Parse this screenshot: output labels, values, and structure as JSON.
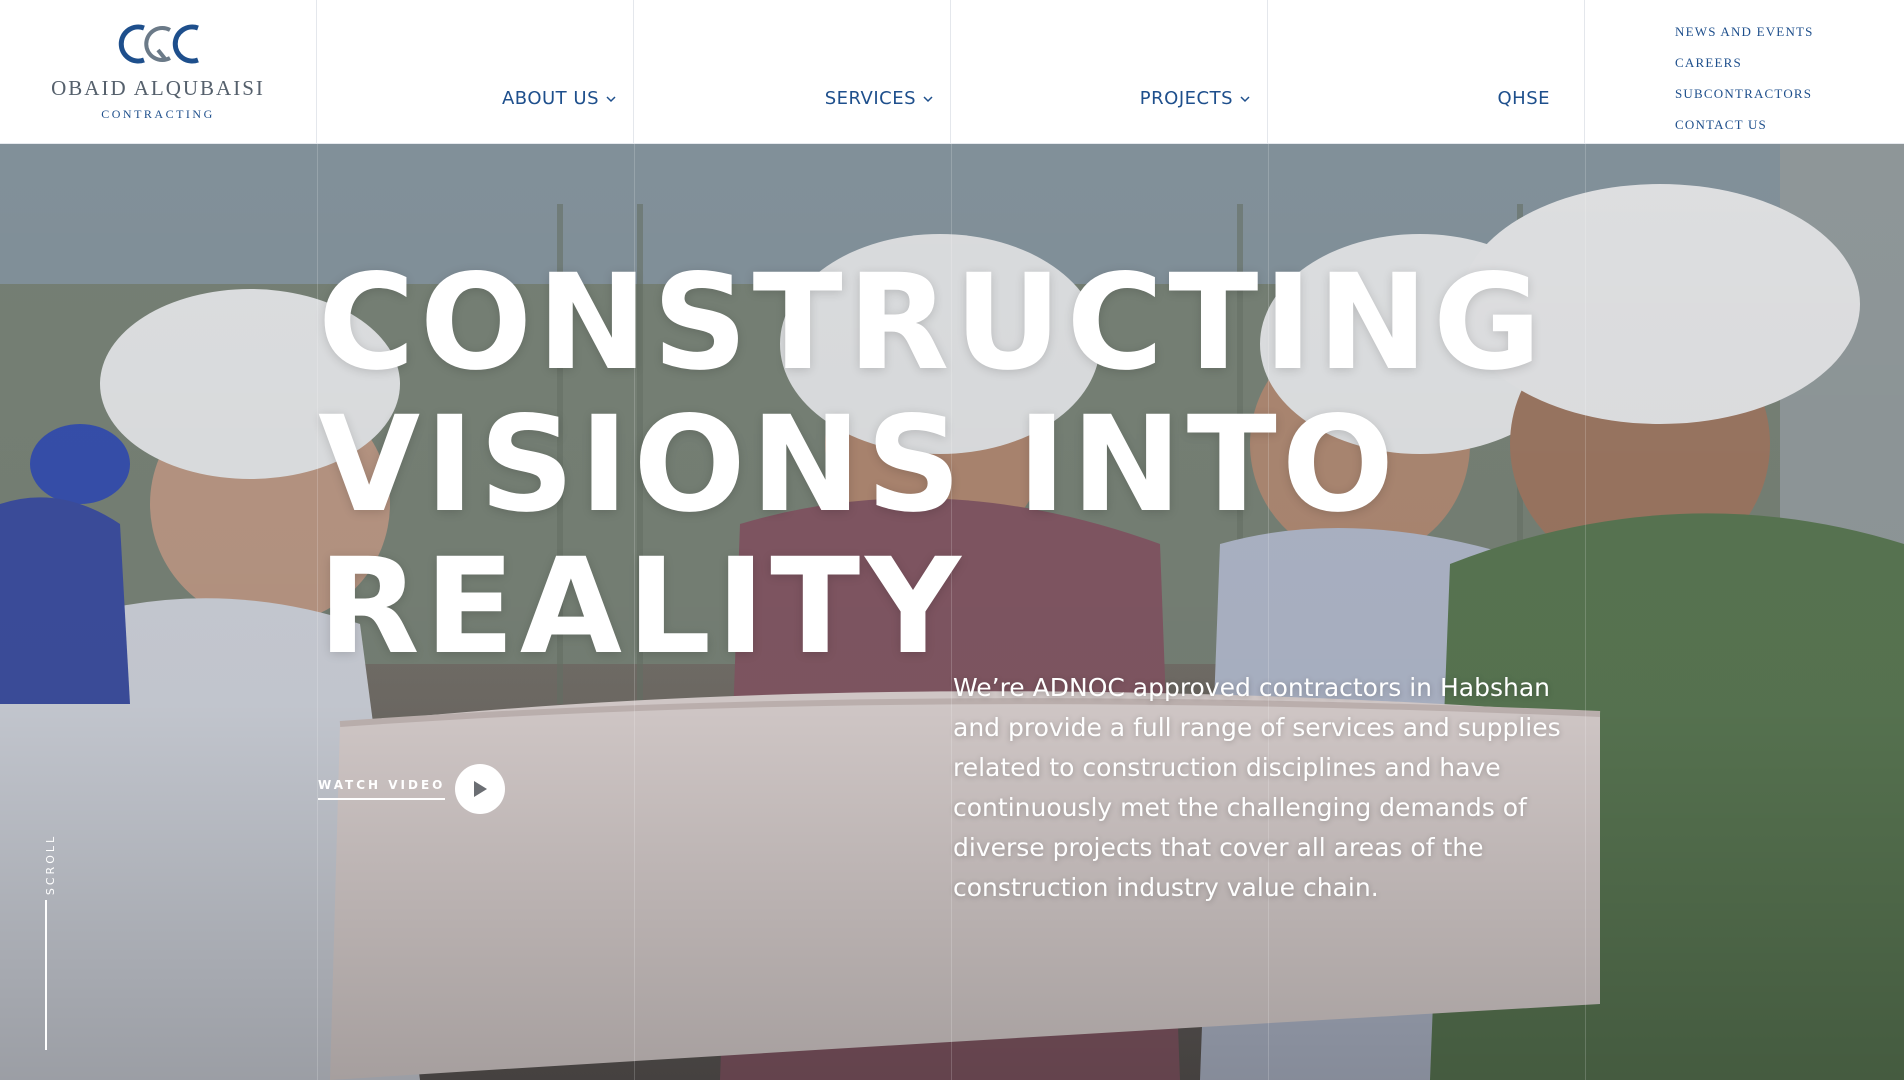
{
  "brand": {
    "name": "OBAID ALQUBAISI",
    "tagline": "CONTRACTING",
    "color": "#1e4f8c"
  },
  "nav": {
    "items": [
      {
        "label": "ABOUT US",
        "dropdown": true
      },
      {
        "label": "SERVICES",
        "dropdown": true
      },
      {
        "label": "PROJECTS",
        "dropdown": true
      },
      {
        "label": "QHSE",
        "dropdown": false
      }
    ],
    "secondary": [
      {
        "label": "NEWS AND EVENTS"
      },
      {
        "label": "CAREERS"
      },
      {
        "label": "SUBCONTRACTORS"
      },
      {
        "label": "CONTACT US"
      }
    ]
  },
  "hero": {
    "headline": [
      "CONSTRUCTING",
      "VISIONS INTO",
      "REALITY"
    ],
    "intro": "We’re ADNOC approved contractors in Habshan and provide a full range of services and supplies related to construction disciplines and have continuously met the challenging demands of diverse projects that cover all areas of the construction industry value chain.",
    "watch_label": "WATCH VIDEO",
    "scroll_label": "SCROLL"
  }
}
